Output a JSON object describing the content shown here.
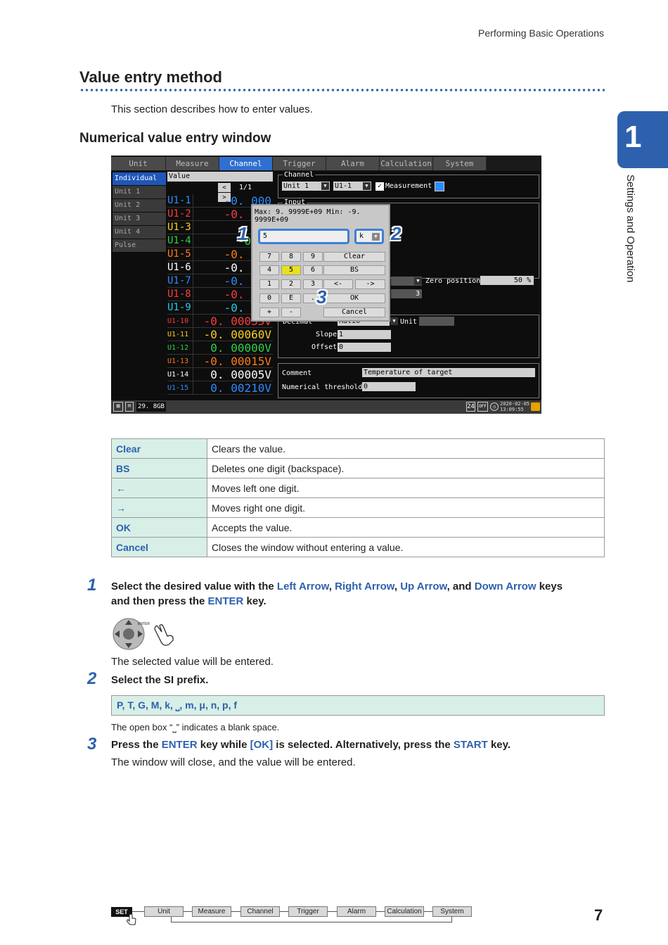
{
  "running_head": "Performing Basic Operations",
  "section_title": "Value entry method",
  "intro": "This section describes how to enter values.",
  "subsection_title": "Numerical value entry window",
  "chapter": {
    "number": "1",
    "title": "Settings and Operation"
  },
  "screen": {
    "tabs": [
      "Unit",
      "Measure",
      "Channel",
      "Trigger",
      "Alarm",
      "Calculation",
      "System"
    ],
    "active_tab": "Channel",
    "side_items": [
      "Individual",
      "Unit 1",
      "Unit 2",
      "Unit 3",
      "Unit 4",
      "Pulse"
    ],
    "value_header": "Value",
    "pager": {
      "prev": "<",
      "page": "1/1",
      "next": ">"
    },
    "channels": [
      {
        "name": "U1-1",
        "value": "-0. 000",
        "color": "#2e8bff"
      },
      {
        "name": "U1-2",
        "value": "-0. 004",
        "color": "#ff3b3b"
      },
      {
        "name": "U1-3",
        "value": "-0",
        "color": "#f5d020"
      },
      {
        "name": "U1-4",
        "value": "-0. 0",
        "color": "#2fd04a"
      },
      {
        "name": "U1-5",
        "value": "-0. 003",
        "color": "#ff7a1a"
      },
      {
        "name": "U1-6",
        "value": "-0. 003",
        "color": "#ffffff"
      },
      {
        "name": "U1-7",
        "value": "-0. 002",
        "color": "#2e8bff"
      },
      {
        "name": "U1-8",
        "value": "-0. 002",
        "color": "#ff3b3b"
      },
      {
        "name": "U1-9",
        "value": "-0. 001",
        "color": "#27c7e6"
      },
      {
        "name": "U1-10",
        "value": "-0. 00035V",
        "color": "#ff3b3b"
      },
      {
        "name": "U1-11",
        "value": "-0. 00060V",
        "color": "#f5d020"
      },
      {
        "name": "U1-12",
        "value": "0. 00000V",
        "color": "#2fd04a"
      },
      {
        "name": "U1-13",
        "value": "-0. 00015V",
        "color": "#ff7a1a"
      },
      {
        "name": "U1-14",
        "value": "0. 00005V",
        "color": "#ffffff"
      },
      {
        "name": "U1-15",
        "value": "0. 00210V",
        "color": "#2e8bff"
      }
    ],
    "channel_group": "Channel",
    "unit_select": "Unit 1",
    "ch_select": "U1-1",
    "measurement_label": "Measurement",
    "input_label": "Input",
    "zero_position_label": "Zero position",
    "zero_position_value": "50 %",
    "num_3": "3",
    "decimal_label": "Decimal",
    "decimal_value": "Ratio",
    "unit_label": "Unit",
    "slope_label": "Slope",
    "slope_value": "1",
    "offset_label": "Offset",
    "offset_value": "0",
    "comment_label": "Comment",
    "comment_value": "Temperature of target",
    "threshold_label": "Numerical threshold",
    "threshold_value": "0",
    "storage": "29. 8GB",
    "clock_date": "2020-02-05",
    "clock_time": "13:09:55",
    "status_24": "24",
    "status_off": "OFF",
    "dialog": {
      "range": "Max: 9. 9999E+09 Min: -9. 9999E+09",
      "input_value": "5",
      "prefix_value": "k",
      "keys": [
        "7",
        "8",
        "9",
        "Clear",
        "4",
        "5",
        "6",
        "BS",
        "1",
        "2",
        "3",
        "<-",
        "->",
        "0",
        "E",
        ".",
        "OK",
        "+",
        "-",
        "Cancel"
      ]
    },
    "callouts": [
      "1",
      "2",
      "3"
    ]
  },
  "key_table": [
    {
      "key": "Clear",
      "desc": "Clears the value."
    },
    {
      "key": "BS",
      "desc": "Deletes one digit (backspace)."
    },
    {
      "key": "←",
      "desc": "Moves left one digit."
    },
    {
      "key": "→",
      "desc": "Moves right one digit."
    },
    {
      "key": "OK",
      "desc": "Accepts the value."
    },
    {
      "key": "Cancel",
      "desc": "Closes the window without entering a value."
    }
  ],
  "steps": {
    "s1_num": "1",
    "s1_a": "Select the desired value with the ",
    "s1_left": "Left Arrow",
    "s1_c1": ", ",
    "s1_right": "Right Arrow",
    "s1_c2": ", ",
    "s1_up": "Up Arrow",
    "s1_c3": ", and ",
    "s1_down": "Down Arrow",
    "s1_b": " keys",
    "s1_line2a": "and then press the ",
    "s1_enter": "ENTER",
    "s1_line2b": " key.",
    "enter_label": "ENTER",
    "s1_result": "The selected value will be entered.",
    "s2_num": "2",
    "s2_text": "Select the SI prefix.",
    "prefixes": "P, T, G, M, k, ⎵, m, μ, n, p, f",
    "s2_note": "The open box “⎵” indicates a blank space.",
    "s3_num": "3",
    "s3_a": "Press the ",
    "s3_enter": "ENTER",
    "s3_b": " key while ",
    "s3_ok": "[OK]",
    "s3_c": " is selected. Alternatively, press the ",
    "s3_start": "START",
    "s3_d": " key.",
    "s3_result": "The window will close, and the value will be entered."
  },
  "footer_nav": {
    "set": "SET",
    "items": [
      "Unit",
      "Measure",
      "Channel",
      "Trigger",
      "Alarm",
      "Calculation",
      "System"
    ]
  },
  "page_number": "7"
}
